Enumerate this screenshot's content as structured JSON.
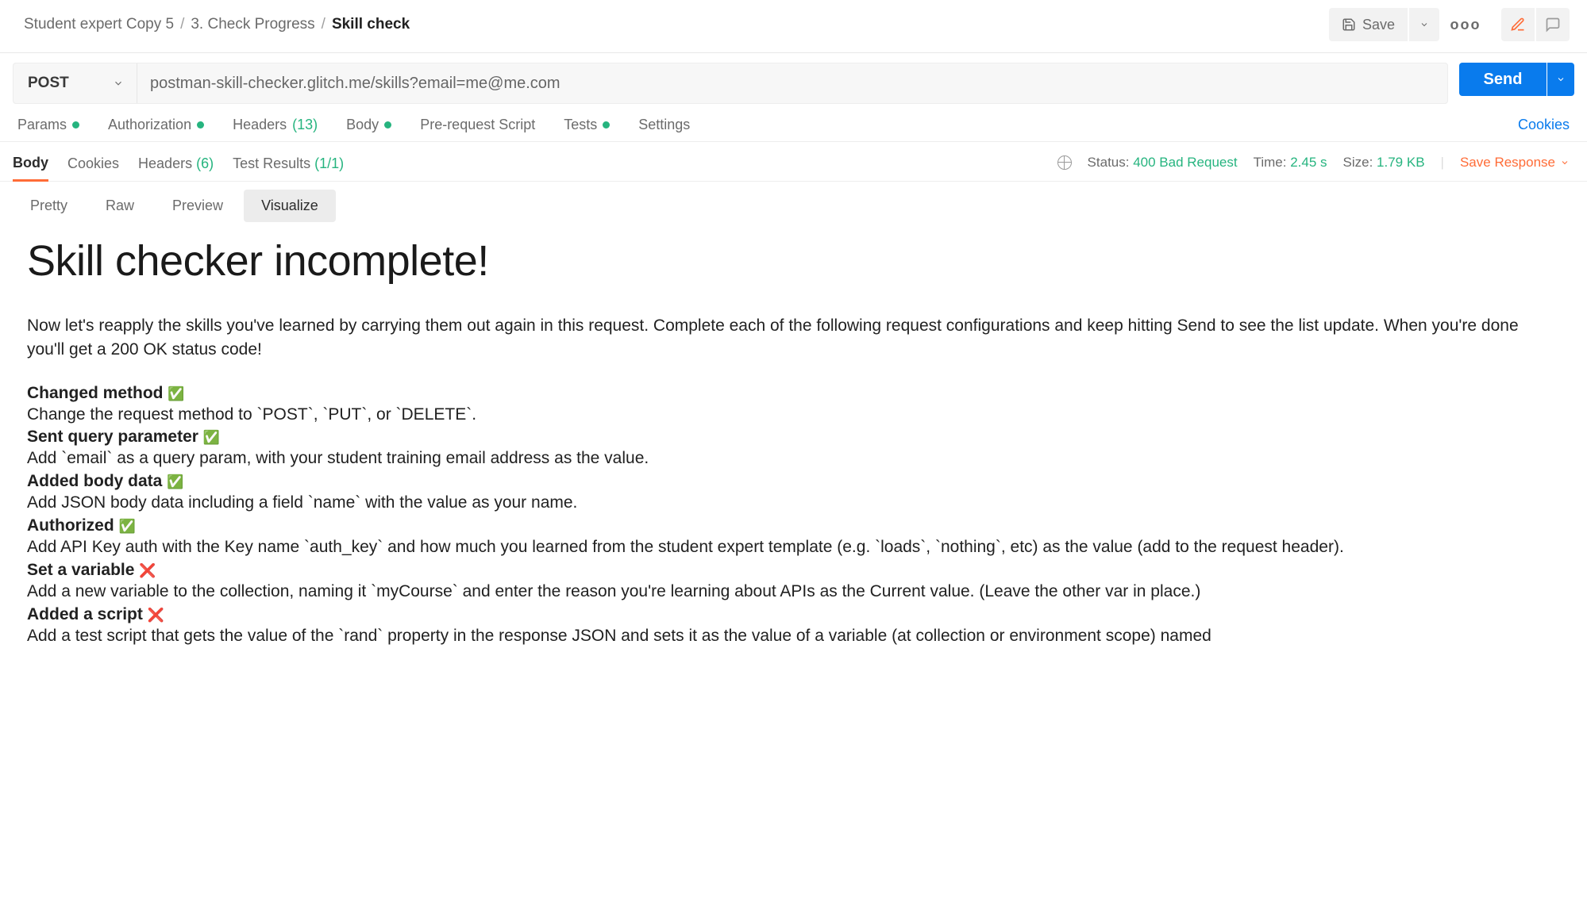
{
  "breadcrumb": {
    "a": "Student expert Copy 5",
    "b": "3. Check Progress",
    "c": "Skill check"
  },
  "toolbar": {
    "save": "Save"
  },
  "request": {
    "method": "POST",
    "url": "postman-skill-checker.glitch.me/skills?email=me@me.com",
    "send": "Send"
  },
  "req_tabs": {
    "params": "Params",
    "auth": "Authorization",
    "headers": "Headers",
    "headers_count": "(13)",
    "body": "Body",
    "prereq": "Pre-request Script",
    "tests": "Tests",
    "settings": "Settings",
    "cookies": "Cookies"
  },
  "resp_tabs": {
    "body": "Body",
    "cookies": "Cookies",
    "headers": "Headers",
    "headers_count": "(6)",
    "tests": "Test Results",
    "tests_count": "(1/1)"
  },
  "resp_meta": {
    "status_label": "Status:",
    "status_val": "400 Bad Request",
    "time_label": "Time:",
    "time_val": "2.45 s",
    "size_label": "Size:",
    "size_val": "1.79 KB",
    "save_response": "Save Response"
  },
  "body_view": {
    "pretty": "Pretty",
    "raw": "Raw",
    "preview": "Preview",
    "visualize": "Visualize"
  },
  "viz": {
    "title": "Skill checker incomplete!",
    "intro": "Now let's reapply the skills you've learned by carrying them out again in this request. Complete each of the following request configurations and keep hitting Send to see the list update. When you're done you'll get a 200 OK status code!",
    "items": [
      {
        "title": "Changed method",
        "status": "✅",
        "desc": "Change the request method to `POST`, `PUT`, or `DELETE`."
      },
      {
        "title": "Sent query parameter",
        "status": "✅",
        "desc": "Add `email` as a query param, with your student training email address as the value."
      },
      {
        "title": "Added body data",
        "status": "✅",
        "desc": "Add JSON body data including a field `name` with the value as your name."
      },
      {
        "title": "Authorized",
        "status": "✅",
        "desc": "Add API Key auth with the Key name `auth_key` and how much you learned from the student expert template (e.g. `loads`, `nothing`, etc) as the value (add to the request header)."
      },
      {
        "title": "Set a variable",
        "status": "❌",
        "desc": "Add a new variable to the collection, naming it `myCourse` and enter the reason you're learning about APIs as the Current value. (Leave the other var in place.)"
      },
      {
        "title": "Added a script",
        "status": "❌",
        "desc": "Add a test script that gets the value of the `rand` property in the response JSON and sets it as the value of a variable (at collection or environment scope) named"
      }
    ]
  }
}
